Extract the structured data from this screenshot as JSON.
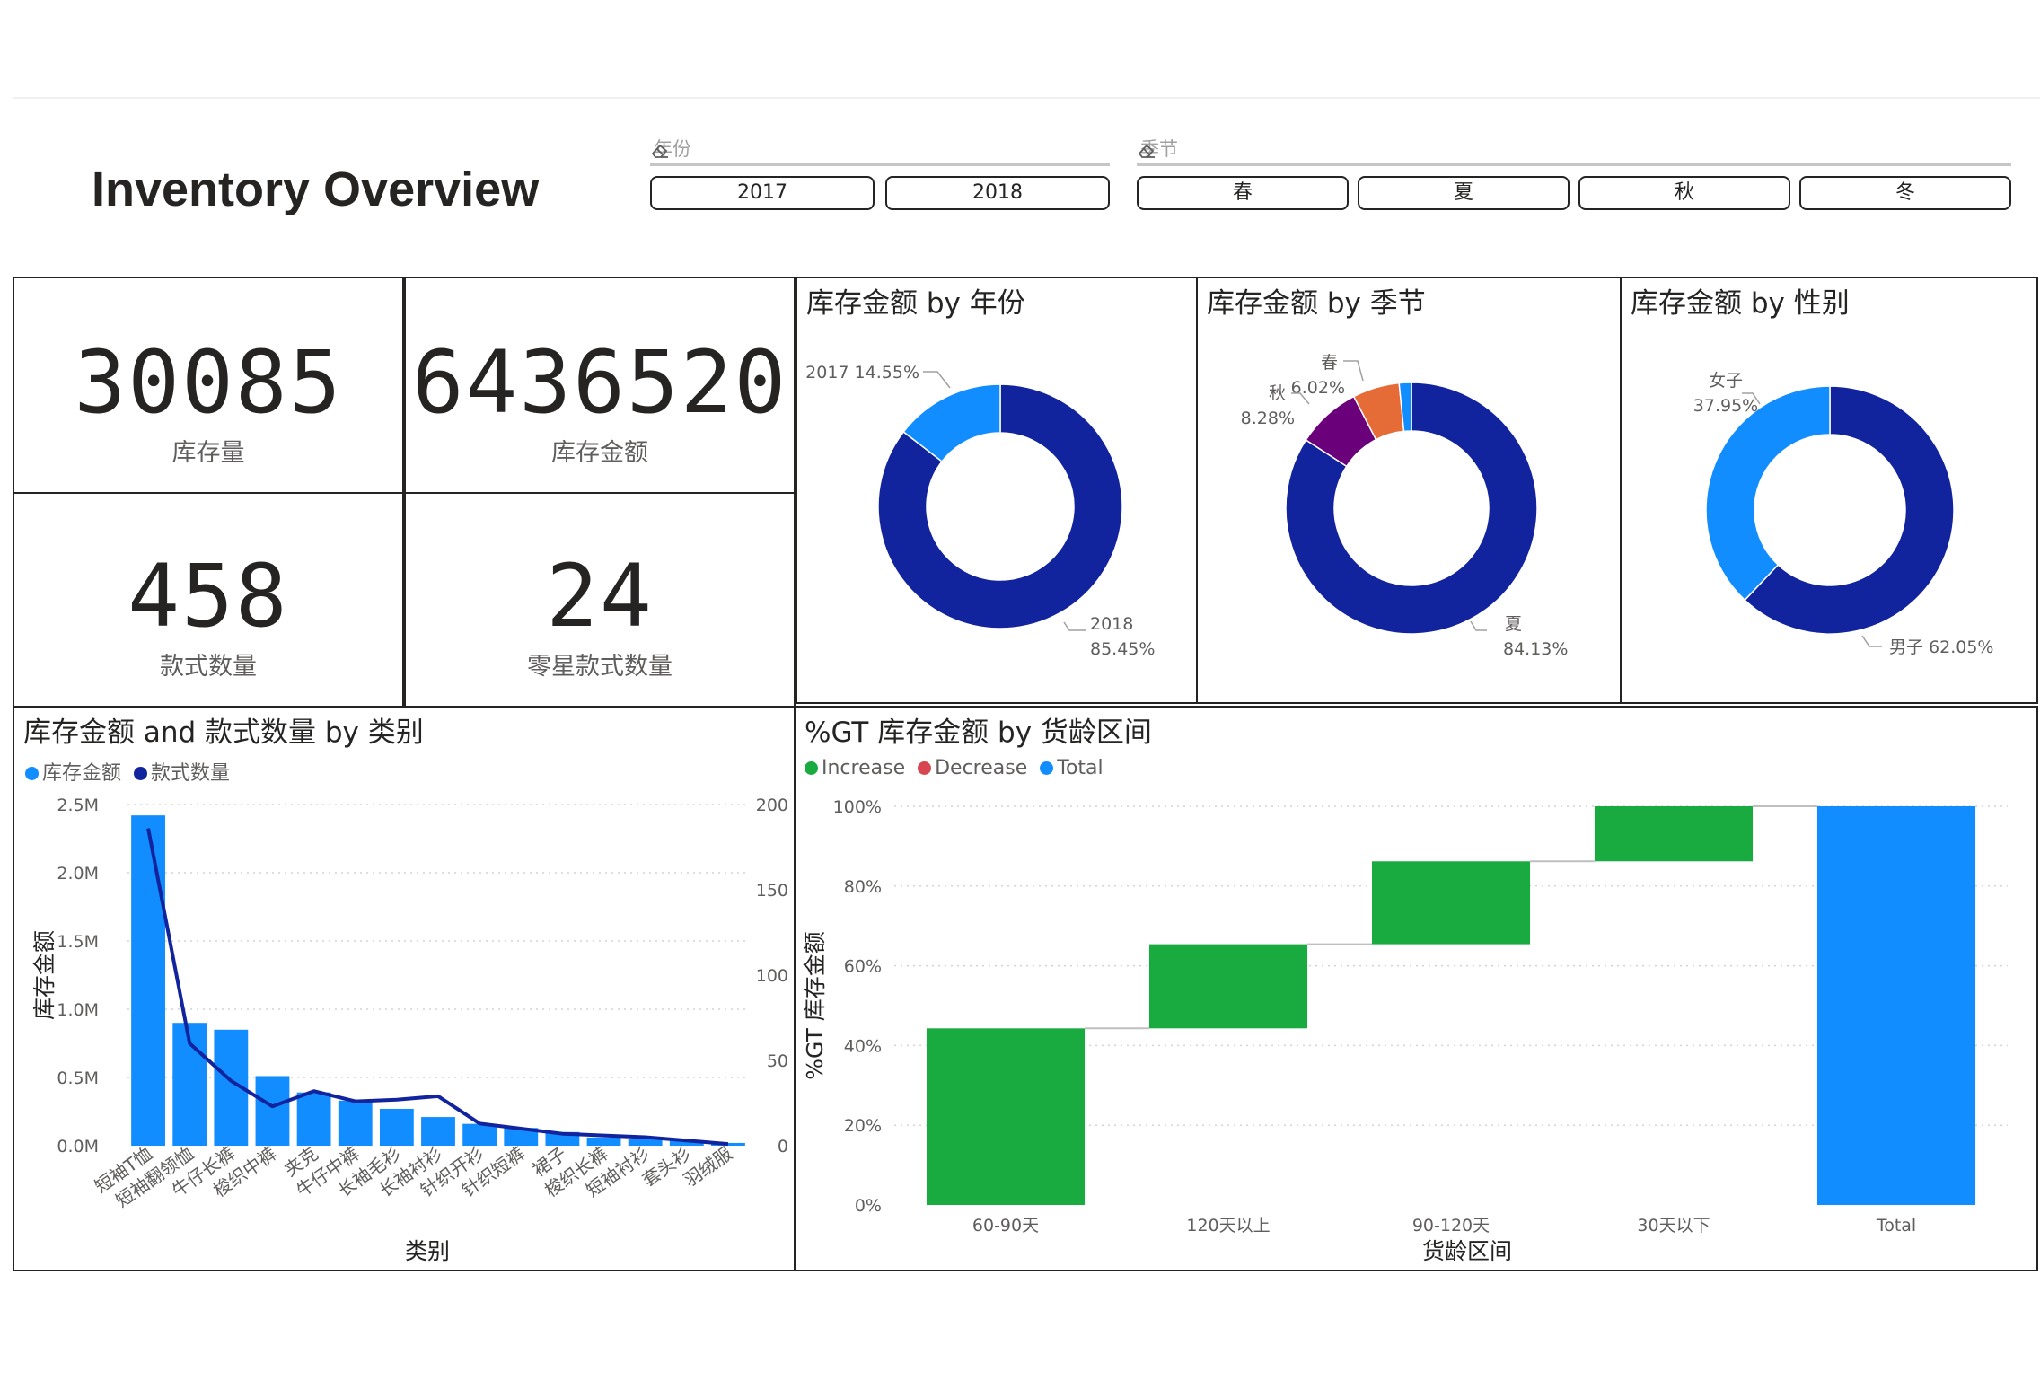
{
  "header": {
    "title": "Inventory Overview"
  },
  "slicers": {
    "year": {
      "label": "年份",
      "options": [
        "2017",
        "2018"
      ]
    },
    "season": {
      "label": "季节",
      "options": [
        "春",
        "夏",
        "秋",
        "冬"
      ]
    }
  },
  "kpis": [
    {
      "value": "30085",
      "label": "库存量"
    },
    {
      "value": "6436520",
      "label": "库存金额"
    },
    {
      "value": "458",
      "label": "款式数量"
    },
    {
      "value": "24",
      "label": "零星款式数量"
    }
  ],
  "colors": {
    "dark_blue": "#12239E",
    "light_blue": "#118DFF",
    "purple": "#6B007B",
    "orange": "#E66C37",
    "green": "#1AAB40",
    "red": "#D64550",
    "connector": "#bfbfbf"
  },
  "chart_data": [
    {
      "type": "pie",
      "title": "库存金额 by 年份",
      "slices": [
        {
          "name": "2018",
          "value": 85.45,
          "label": "85.45%",
          "color": "#12239E"
        },
        {
          "name": "2017",
          "value": 14.55,
          "label": "14.55%",
          "color": "#118DFF"
        }
      ]
    },
    {
      "type": "pie",
      "title": "库存金额 by 季节",
      "slices": [
        {
          "name": "夏",
          "value": 84.13,
          "label": "84.13%",
          "color": "#12239E"
        },
        {
          "name": "秋",
          "value": 8.28,
          "label": "8.28%",
          "color": "#6B007B"
        },
        {
          "name": "春",
          "value": 6.02,
          "label": "6.02%",
          "color": "#E66C37"
        },
        {
          "name": "",
          "value": 1.57,
          "label": "",
          "color": "#118DFF"
        }
      ]
    },
    {
      "type": "pie",
      "title": "库存金额 by 性别",
      "slices": [
        {
          "name": "男子",
          "value": 62.05,
          "label": "62.05%",
          "color": "#12239E"
        },
        {
          "name": "女子",
          "value": 37.95,
          "label": "37.95%",
          "color": "#118DFF"
        }
      ]
    },
    {
      "type": "bar",
      "title": "库存金额 and 款式数量 by 类别",
      "xlabel": "类别",
      "ylabel": "库存金额",
      "ylim": [
        0,
        2500000
      ],
      "y2lim": [
        0,
        200
      ],
      "yticks": [
        "0.0M",
        "0.5M",
        "1.0M",
        "1.5M",
        "2.0M",
        "2.5M"
      ],
      "y2ticks": [
        "0",
        "50",
        "100",
        "150",
        "200"
      ],
      "categories": [
        "短袖T恤",
        "短袖翻领恤",
        "牛仔长裤",
        "梭织中裤",
        "夹克",
        "牛仔中裤",
        "长袖毛衫",
        "长袖衬衫",
        "针织开衫",
        "针织短裤",
        "裙子",
        "梭织长裤",
        "短袖衬衫",
        "套头衫",
        "羽绒服"
      ],
      "series": [
        {
          "name": "库存金额",
          "kind": "bar",
          "color": "#118DFF",
          "values": [
            2420000,
            900000,
            850000,
            510000,
            390000,
            330000,
            270000,
            210000,
            160000,
            130000,
            100000,
            60000,
            50000,
            40000,
            20000
          ]
        },
        {
          "name": "款式数量",
          "kind": "line",
          "color": "#12239E",
          "values": [
            186,
            60,
            38,
            23,
            32,
            26,
            27,
            29,
            13,
            10,
            7,
            6,
            5,
            3,
            1
          ]
        }
      ]
    },
    {
      "type": "bar",
      "subtype": "waterfall",
      "title": "%GT 库存金额 by 货龄区间",
      "xlabel": "货龄区间",
      "ylabel": "%GT 库存金额",
      "ylim": [
        0,
        100
      ],
      "yticks": [
        "0%",
        "20%",
        "40%",
        "60%",
        "80%",
        "100%"
      ],
      "legend": [
        "Increase",
        "Decrease",
        "Total"
      ],
      "categories": [
        "60-90天",
        "120天以上",
        "90-120天",
        "30天以下",
        "Total"
      ],
      "values": [
        44.3,
        21.1,
        20.8,
        13.8,
        100
      ],
      "kinds": [
        "increase",
        "increase",
        "increase",
        "increase",
        "total"
      ]
    }
  ]
}
